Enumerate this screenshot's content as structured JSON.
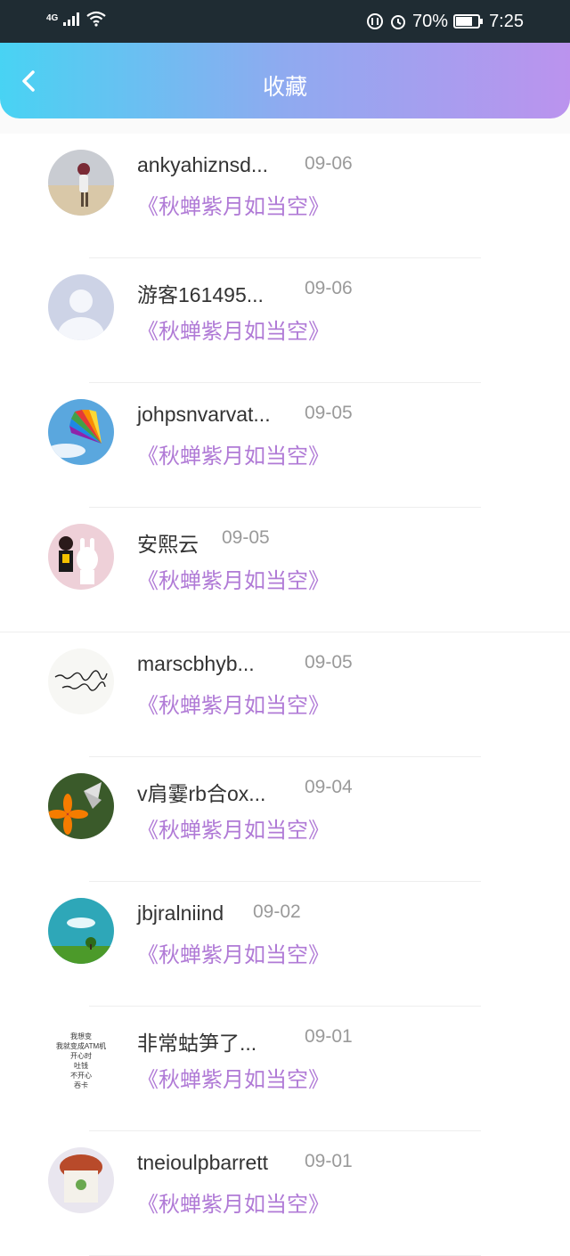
{
  "status": {
    "network": "4G",
    "battery": "70%",
    "time": "7:25"
  },
  "header": {
    "title": "收藏"
  },
  "items": [
    {
      "name": "ankyahiznsd...",
      "date": "09-06",
      "work": "《秋蝉紫月如当空》",
      "avatar": "beach-photo"
    },
    {
      "name": "游客161495...",
      "date": "09-06",
      "work": "《秋蝉紫月如当空》",
      "avatar": "default-user"
    },
    {
      "name": "johpsnvarvat...",
      "date": "09-05",
      "work": "《秋蝉紫月如当空》",
      "avatar": "rainbow-fan"
    },
    {
      "name": "安熙云",
      "date": "09-05",
      "work": "《秋蝉紫月如当空》",
      "avatar": "girl-with-bunny"
    },
    {
      "name": "marscbhyb...",
      "date": "09-05",
      "work": "《秋蝉紫月如当空》",
      "avatar": "calligraphy"
    },
    {
      "name": "v肩霎rb合ox...",
      "date": "09-04",
      "work": "《秋蝉紫月如当空》",
      "avatar": "butterfly-flower"
    },
    {
      "name": "jbjralniind",
      "date": "09-02",
      "work": "《秋蝉紫月如当空》",
      "avatar": "sky-tree"
    },
    {
      "name": "非常蛄笋了...",
      "date": "09-01",
      "work": "《秋蝉紫月如当空》",
      "avatar": "text-note",
      "avatar_text": [
        "我想变",
        "我就变成ATM机",
        "开心时",
        "吐钱",
        "不开心",
        "吞卡"
      ]
    },
    {
      "name": "tneioulpbarrett",
      "date": "09-01",
      "work": "《秋蝉紫月如当空》",
      "avatar": "cartoon-picture"
    }
  ]
}
